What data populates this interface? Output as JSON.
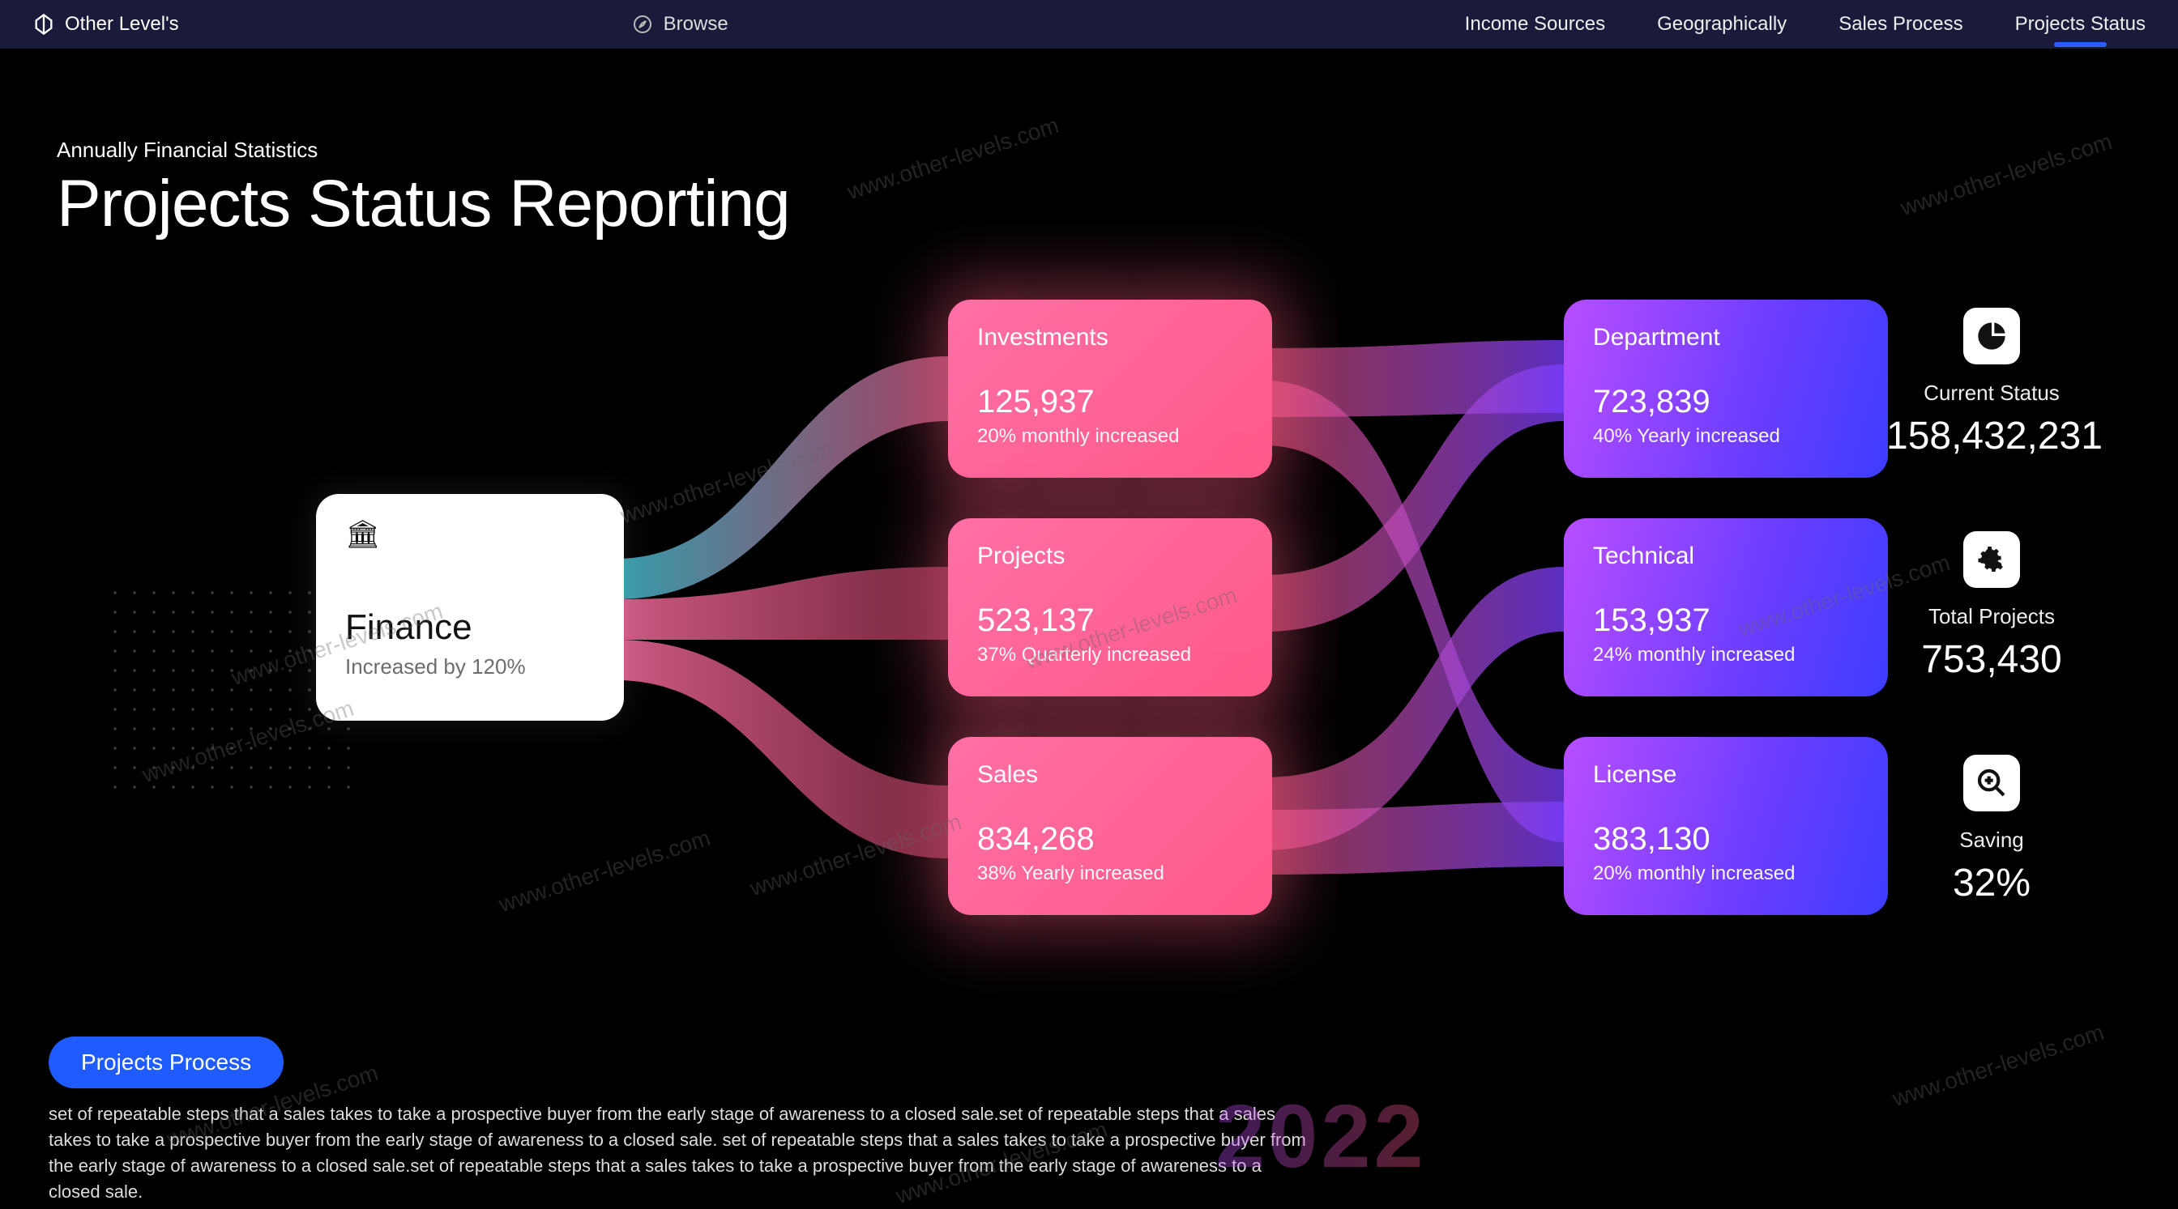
{
  "nav": {
    "brand": "Other Level's",
    "browse": "Browse",
    "links": [
      "Income Sources",
      "Geographically",
      "Sales Process",
      "Projects Status"
    ],
    "active": 3
  },
  "header": {
    "subtitle": "Annually Financial Statistics",
    "title": "Projects Status Reporting"
  },
  "chart_data": {
    "type": "sankey",
    "source": {
      "name": "Finance",
      "sub": "Increased by 120%",
      "icon": "bank-icon"
    },
    "middle": [
      {
        "name": "Investments",
        "value": 125937,
        "value_str": "125,937",
        "sub": "20% monthly increased"
      },
      {
        "name": "Projects",
        "value": 523137,
        "value_str": "523,137",
        "sub": "37% Quarterly increased"
      },
      {
        "name": "Sales",
        "value": 834268,
        "value_str": "834,268",
        "sub": "38% Yearly increased"
      }
    ],
    "right": [
      {
        "name": "Department",
        "value": 723839,
        "value_str": "723,839",
        "sub": "40% Yearly increased"
      },
      {
        "name": "Technical",
        "value": 153937,
        "value_str": "153,937",
        "sub": "24% monthly increased"
      },
      {
        "name": "License",
        "value": 383130,
        "value_str": "383,130",
        "sub": "20% monthly increased"
      }
    ]
  },
  "stats": [
    {
      "icon": "pie-icon",
      "name": "Current Status",
      "value": "158,432,231"
    },
    {
      "icon": "gear-icon",
      "name": "Total Projects",
      "value": "753,430"
    },
    {
      "icon": "search-icon",
      "name": "Saving",
      "value": "32%"
    }
  ],
  "footer": {
    "pill": "Projects Process",
    "desc": "set of repeatable steps that a sales takes to take a prospective buyer from the early stage of awareness to a closed sale.set of repeatable steps that a sales takes to take a prospective buyer from the early stage of awareness to a closed sale. set of repeatable steps that a sales takes to take a prospective buyer from the early stage of awareness to a closed sale.set of repeatable steps that a sales takes to take a prospective buyer from the early stage of awareness to a closed sale.",
    "year": "2022"
  },
  "watermark": "www.other-levels.com"
}
